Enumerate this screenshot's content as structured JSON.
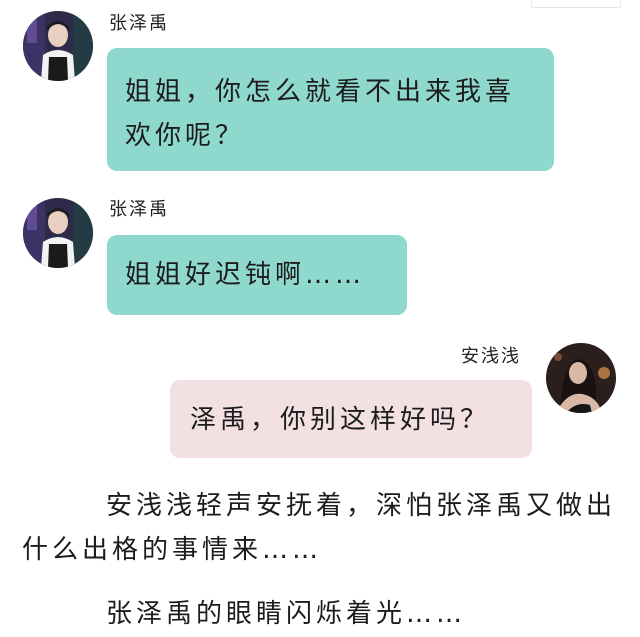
{
  "messages": [
    {
      "sender": "张泽禹",
      "side": "left",
      "avatar_icon": "boy-portrait-avatar",
      "text": "姐姐，你怎么就看不出来我喜欢你呢？"
    },
    {
      "sender": "张泽禹",
      "side": "left",
      "avatar_icon": "boy-portrait-avatar",
      "text": "姐姐好迟钝啊……"
    },
    {
      "sender": "安浅浅",
      "side": "right",
      "avatar_icon": "girl-portrait-avatar",
      "text": "泽禹，你别这样好吗？"
    }
  ],
  "narration": [
    "安浅浅轻声安抚着，深怕张泽禹又做出什么出格的事情来……",
    "张泽禹的眼睛闪烁着光……"
  ],
  "colors": {
    "left_bubble": "#8fd8ce",
    "right_bubble": "#f3e0e2",
    "text": "#1c1c1c"
  }
}
